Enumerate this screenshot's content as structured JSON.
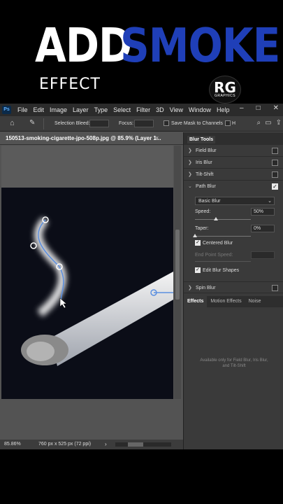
{
  "headline": {
    "word1": "ADD",
    "word2": "SMOKE",
    "subtitle": "EFFECT",
    "logo_main": "RG",
    "logo_sub": "GRAPHICS"
  },
  "menubar": {
    "items": [
      "File",
      "Edit",
      "Image",
      "Layer",
      "Type",
      "Select",
      "Filter",
      "3D",
      "View",
      "Window",
      "Help"
    ],
    "controls": [
      "–",
      "□",
      "✕"
    ]
  },
  "options_bar": {
    "selection_bleed_label": "Selection Bleed:",
    "focus_label": "Focus:",
    "save_mask_label": "Save Mask to Channels",
    "heal_label": "H"
  },
  "document": {
    "tab_title": "150513-smoking-cigarette-jpo-508p.jpg @ 85.9% (Layer 1...",
    "close": "×"
  },
  "status": {
    "zoom": "85.86%",
    "dimensions": "760 px x 525 px (72 ppi)",
    "arrow": "›"
  },
  "blur_panel": {
    "tab": "Blur Tools",
    "field_blur": "Field Blur",
    "iris_blur": "Iris Blur",
    "tilt_shift": "Tilt-Shift",
    "path_blur": "Path Blur",
    "path_blur_checked": true,
    "mode": "Basic Blur",
    "speed_label": "Speed:",
    "speed_value": "50%",
    "speed_fraction": 0.5,
    "taper_label": "Taper:",
    "taper_value": "0%",
    "taper_fraction": 0.0,
    "centered_blur": "Centered Blur",
    "end_point_speed": "End Point Speed:",
    "edit_blur_shapes": "Edit Blur Shapes",
    "spin_blur": "Spin Blur"
  },
  "effects_panel": {
    "tabs": [
      "Effects",
      "Motion Effects",
      "Noise"
    ],
    "note": "Available only for Field Blur, Iris Blur, and Tilt-Shift"
  },
  "colors": {
    "accent_blue": "#1f3fb8",
    "path_blue": "#5b8fe0",
    "panel_bg": "#3a3a3a"
  }
}
